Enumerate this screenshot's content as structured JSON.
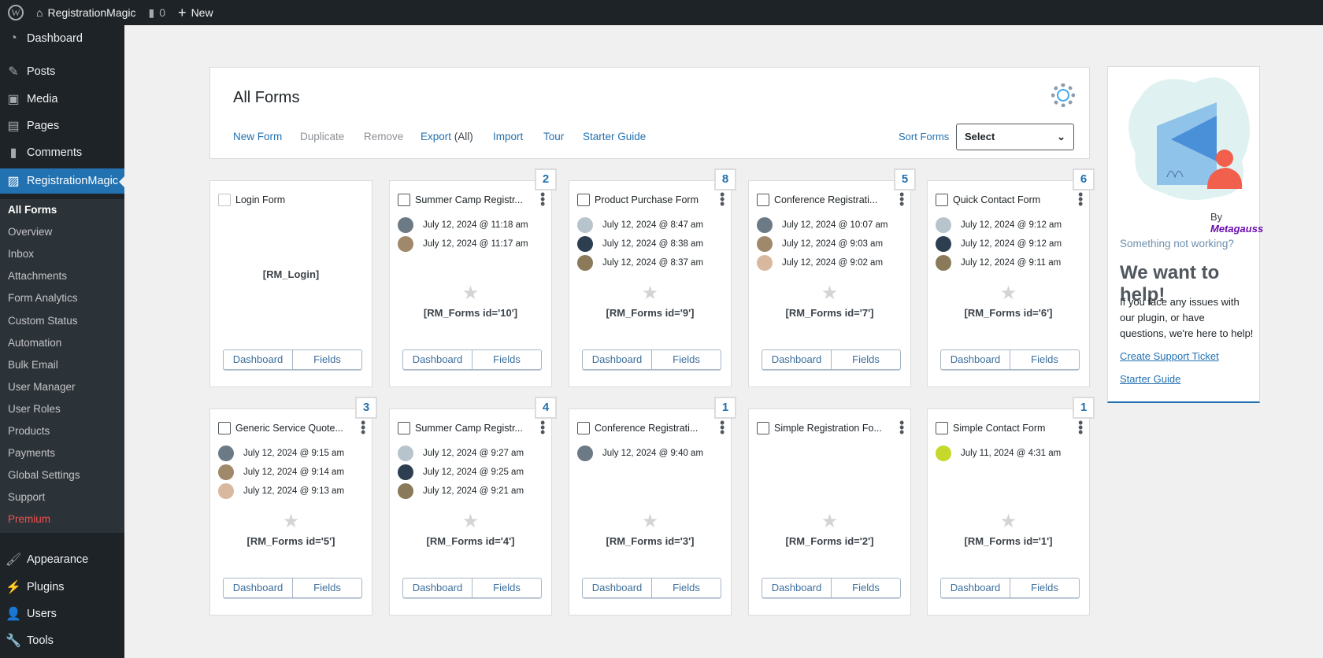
{
  "topbar": {
    "site": "RegistrationMagic",
    "comments": "0",
    "new": "New"
  },
  "sidebar": {
    "top": [
      {
        "label": "Dashboard",
        "icon": "dashboard-icon"
      },
      {
        "label": "Posts",
        "icon": "pin-icon"
      },
      {
        "label": "Media",
        "icon": "media-icon"
      },
      {
        "label": "Pages",
        "icon": "pages-icon"
      },
      {
        "label": "Comments",
        "icon": "comment-icon"
      },
      {
        "label": "RegistrationMagic",
        "icon": "registrationmagic-icon"
      }
    ],
    "submenu": [
      "All Forms",
      "Overview",
      "Inbox",
      "Attachments",
      "Form Analytics",
      "Custom Status",
      "Automation",
      "Bulk Email",
      "User Manager",
      "User Roles",
      "Products",
      "Payments",
      "Global Settings",
      "Support",
      "Premium"
    ],
    "bottom": [
      {
        "label": "Appearance"
      },
      {
        "label": "Plugins"
      },
      {
        "label": "Users"
      },
      {
        "label": "Tools"
      }
    ]
  },
  "header": {
    "title": "All Forms",
    "links": {
      "new_form": "New Form",
      "duplicate": "Duplicate",
      "remove": "Remove",
      "export": "Export",
      "export_all": "(All)",
      "import": "Import",
      "tour": "Tour",
      "starter": "Starter Guide"
    },
    "sort_label": "Sort Forms",
    "sort_value": "Select"
  },
  "buttons": {
    "dashboard": "Dashboard",
    "fields": "Fields"
  },
  "forms": [
    {
      "title": "Login Form",
      "badge": "",
      "code": "[RM_Login]",
      "entries": []
    },
    {
      "title": "Summer Camp Registr...",
      "badge": "2",
      "code": "[RM_Forms id='10']",
      "entries": [
        "July 12, 2024 @ 11:18 am",
        "July 12, 2024 @ 11:17 am"
      ]
    },
    {
      "title": "Product Purchase Form",
      "badge": "8",
      "code": "[RM_Forms id='9']",
      "entries": [
        "July 12, 2024 @ 8:47 am",
        "July 12, 2024 @ 8:38 am",
        "July 12, 2024 @ 8:37 am"
      ]
    },
    {
      "title": "Conference Registrati...",
      "badge": "5",
      "code": "[RM_Forms id='7']",
      "entries": [
        "July 12, 2024 @ 10:07 am",
        "July 12, 2024 @ 9:03 am",
        "July 12, 2024 @ 9:02 am"
      ]
    },
    {
      "title": "Quick Contact Form",
      "badge": "6",
      "code": "[RM_Forms id='6']",
      "entries": [
        "July 12, 2024 @ 9:12 am",
        "July 12, 2024 @ 9:12 am",
        "July 12, 2024 @ 9:11 am"
      ]
    },
    {
      "title": "Generic Service Quote...",
      "badge": "3",
      "code": "[RM_Forms id='5']",
      "entries": [
        "July 12, 2024 @ 9:15 am",
        "July 12, 2024 @ 9:14 am",
        "July 12, 2024 @ 9:13 am"
      ]
    },
    {
      "title": "Summer Camp Registr...",
      "badge": "4",
      "code": "[RM_Forms id='4']",
      "entries": [
        "July 12, 2024 @ 9:27 am",
        "July 12, 2024 @ 9:25 am",
        "July 12, 2024 @ 9:21 am"
      ]
    },
    {
      "title": "Conference Registrati...",
      "badge": "1",
      "code": "[RM_Forms id='3']",
      "entries": [
        "July 12, 2024 @ 9:40 am"
      ]
    },
    {
      "title": "Simple Registration Fo...",
      "badge": "",
      "code": "[RM_Forms id='2']",
      "entries": []
    },
    {
      "title": "Simple Contact Form",
      "badge": "1",
      "code": "[RM_Forms id='1']",
      "entries": [
        "July 11, 2024 @ 4:31 am"
      ]
    }
  ],
  "help": {
    "brand_by": "By",
    "brand": "Metagauss",
    "question": "Something not working?",
    "title": "We want to help!",
    "body": "If you face any issues with our plugin, or have questions, we're here to help!",
    "ticket": "Create Support Ticket",
    "guide": "Starter Guide"
  },
  "colors": {
    "accent": "#2271b1",
    "sidebar": "#1d2327",
    "premium": "#f05050"
  }
}
